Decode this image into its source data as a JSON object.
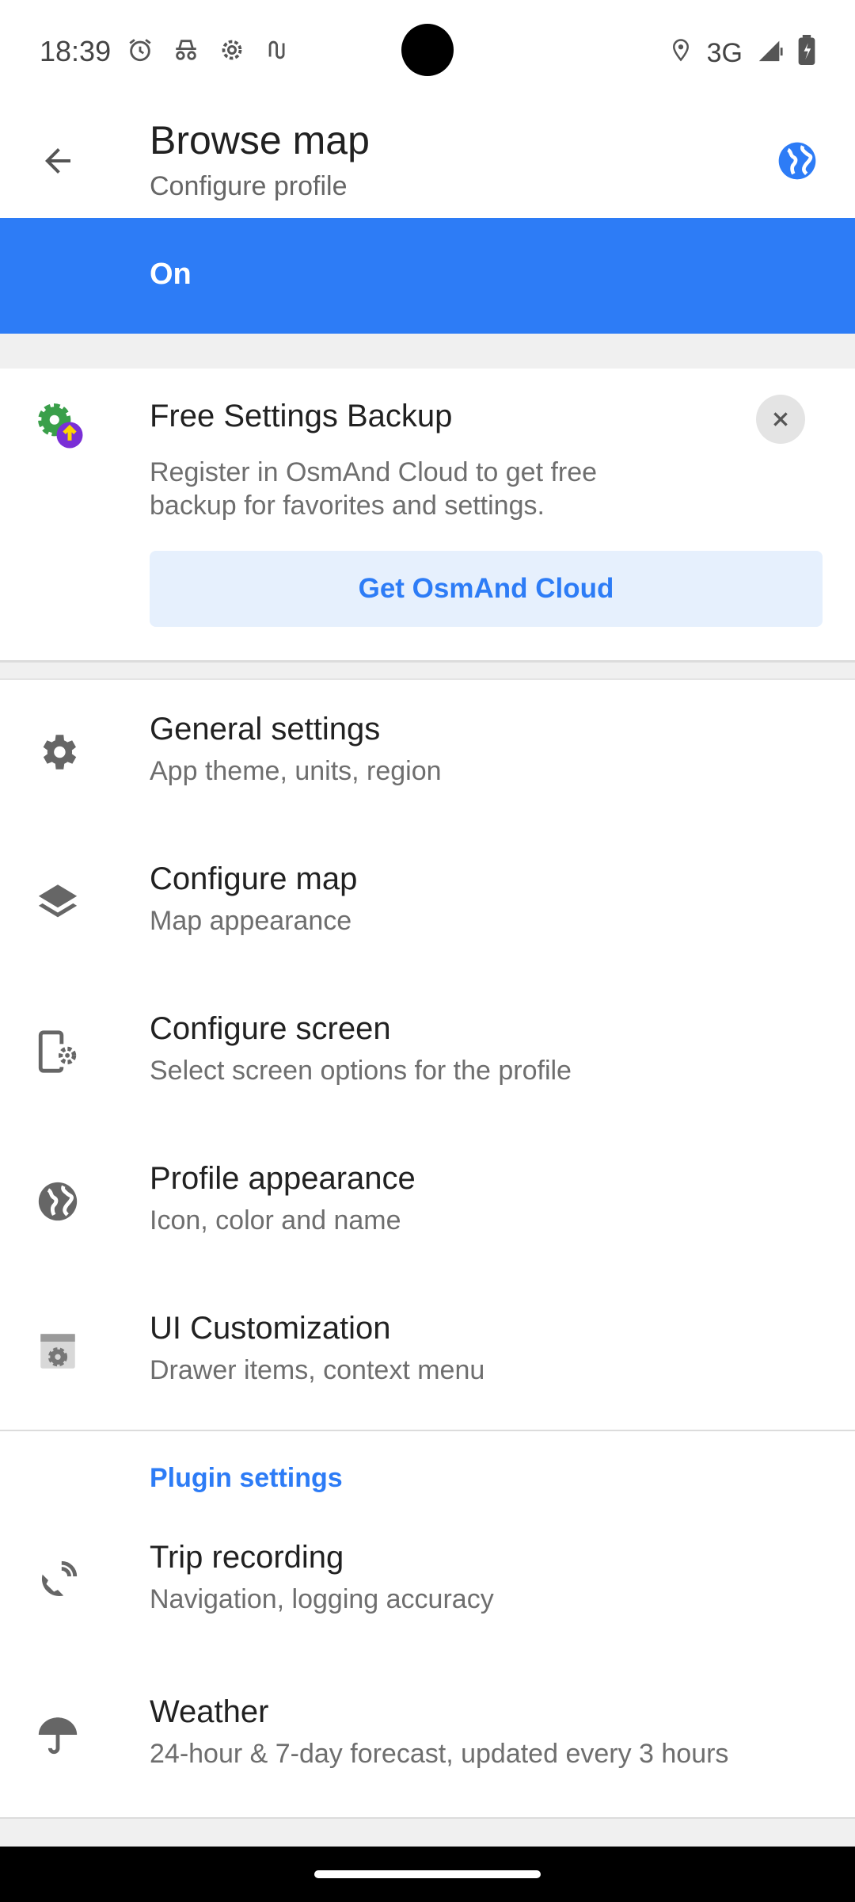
{
  "status_bar": {
    "time": "18:39",
    "network": "3G",
    "icons_left": [
      "alarm-icon",
      "incognito-icon",
      "settings-cog-icon",
      "tasker-icon"
    ],
    "icons_right": [
      "location-icon",
      "signal-icon",
      "battery-icon"
    ]
  },
  "appbar": {
    "title": "Browse map",
    "subtitle": "Configure profile"
  },
  "profile_toggle": {
    "label": "On",
    "color": "#2d7cf6"
  },
  "backup_card": {
    "title": "Free Settings Backup",
    "description": "Register in OsmAnd Cloud to get free backup for favorites and settings.",
    "button_label": "Get OsmAnd Cloud"
  },
  "settings": [
    {
      "title": "General settings",
      "subtitle": "App theme, units, region",
      "icon": "gear-icon"
    },
    {
      "title": "Configure map",
      "subtitle": "Map appearance",
      "icon": "layers-icon"
    },
    {
      "title": "Configure screen",
      "subtitle": "Select screen options for the profile",
      "icon": "screen-settings-icon"
    },
    {
      "title": "Profile appearance",
      "subtitle": "Icon, color and name",
      "icon": "globe-icon"
    },
    {
      "title": "UI Customization",
      "subtitle": "Drawer items, context menu",
      "icon": "ui-customization-icon"
    }
  ],
  "plugin_section": {
    "header": "Plugin settings",
    "items": [
      {
        "title": "Trip recording",
        "subtitle": "Navigation, logging accuracy",
        "icon": "trip-recording-icon"
      },
      {
        "title": "Weather",
        "subtitle": "24-hour & 7-day forecast, updated every 3 hours",
        "icon": "umbrella-icon"
      }
    ]
  }
}
